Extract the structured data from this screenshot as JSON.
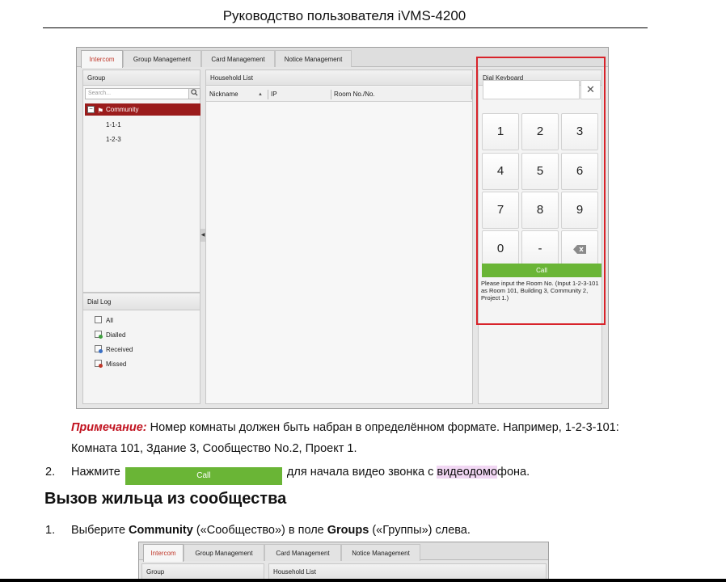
{
  "doc": {
    "header": "Руководство пользователя iVMS-4200"
  },
  "screenshot1": {
    "tabs": [
      "Intercom",
      "Group Management",
      "Card Management",
      "Notice Management"
    ],
    "group_panel": {
      "title": "Group",
      "search_placeholder": "Search...",
      "search_icon": "magnifier-icon",
      "tree_root": "Community",
      "tree_children": [
        "1-1-1",
        "1-2-3"
      ]
    },
    "dial_log": {
      "title": "Dial Log",
      "items": [
        "All",
        "Dialled",
        "Received",
        "Missed"
      ]
    },
    "household": {
      "title": "Household List",
      "columns": [
        "Nickname",
        "IP",
        "Room No./No."
      ],
      "sort_indicator": "▲"
    },
    "dial_keyboard": {
      "title": "Dial Keyboard",
      "clear_symbol": "✕",
      "keys": [
        "1",
        "2",
        "3",
        "4",
        "5",
        "6",
        "7",
        "8",
        "9",
        "0",
        "-"
      ],
      "backspace_icon": "backspace-icon",
      "call_label": "Call",
      "hint": "Please input the Room No. (Input 1-2-3-101 as Room 101, Building 3, Community 2, Project 1.)"
    },
    "colors": {
      "highlight": "#d8232a",
      "call_green": "#6ab536",
      "selected_row": "#9b1c1c"
    }
  },
  "body": {
    "note_label": "Примечание:",
    "note_text": " Номер комнаты должен быть набран в определённом формате. Например, 1-2-3-101: Комната 101, Здание 3, Сообщество No.2, Проект 1.",
    "step2_num": "2.",
    "step2_before": "Нажмите",
    "step2_button": "Call",
    "step2_after_a": "для начала видео звонка с ",
    "step2_mark": "видеодомо",
    "step2_after_b": "фона.",
    "section_heading": "Вызов жильца из сообщества",
    "step1_num": "1.",
    "step1_a": "Выберите ",
    "step1_b": "Community",
    "step1_c": " («Сообщество») в поле ",
    "step1_d": "Groups",
    "step1_e": " («Группы») слева."
  },
  "screenshot2": {
    "tabs": [
      "Intercom",
      "Group Management",
      "Card Management",
      "Notice Management"
    ],
    "group_title": "Group",
    "household_title": "Household List"
  }
}
